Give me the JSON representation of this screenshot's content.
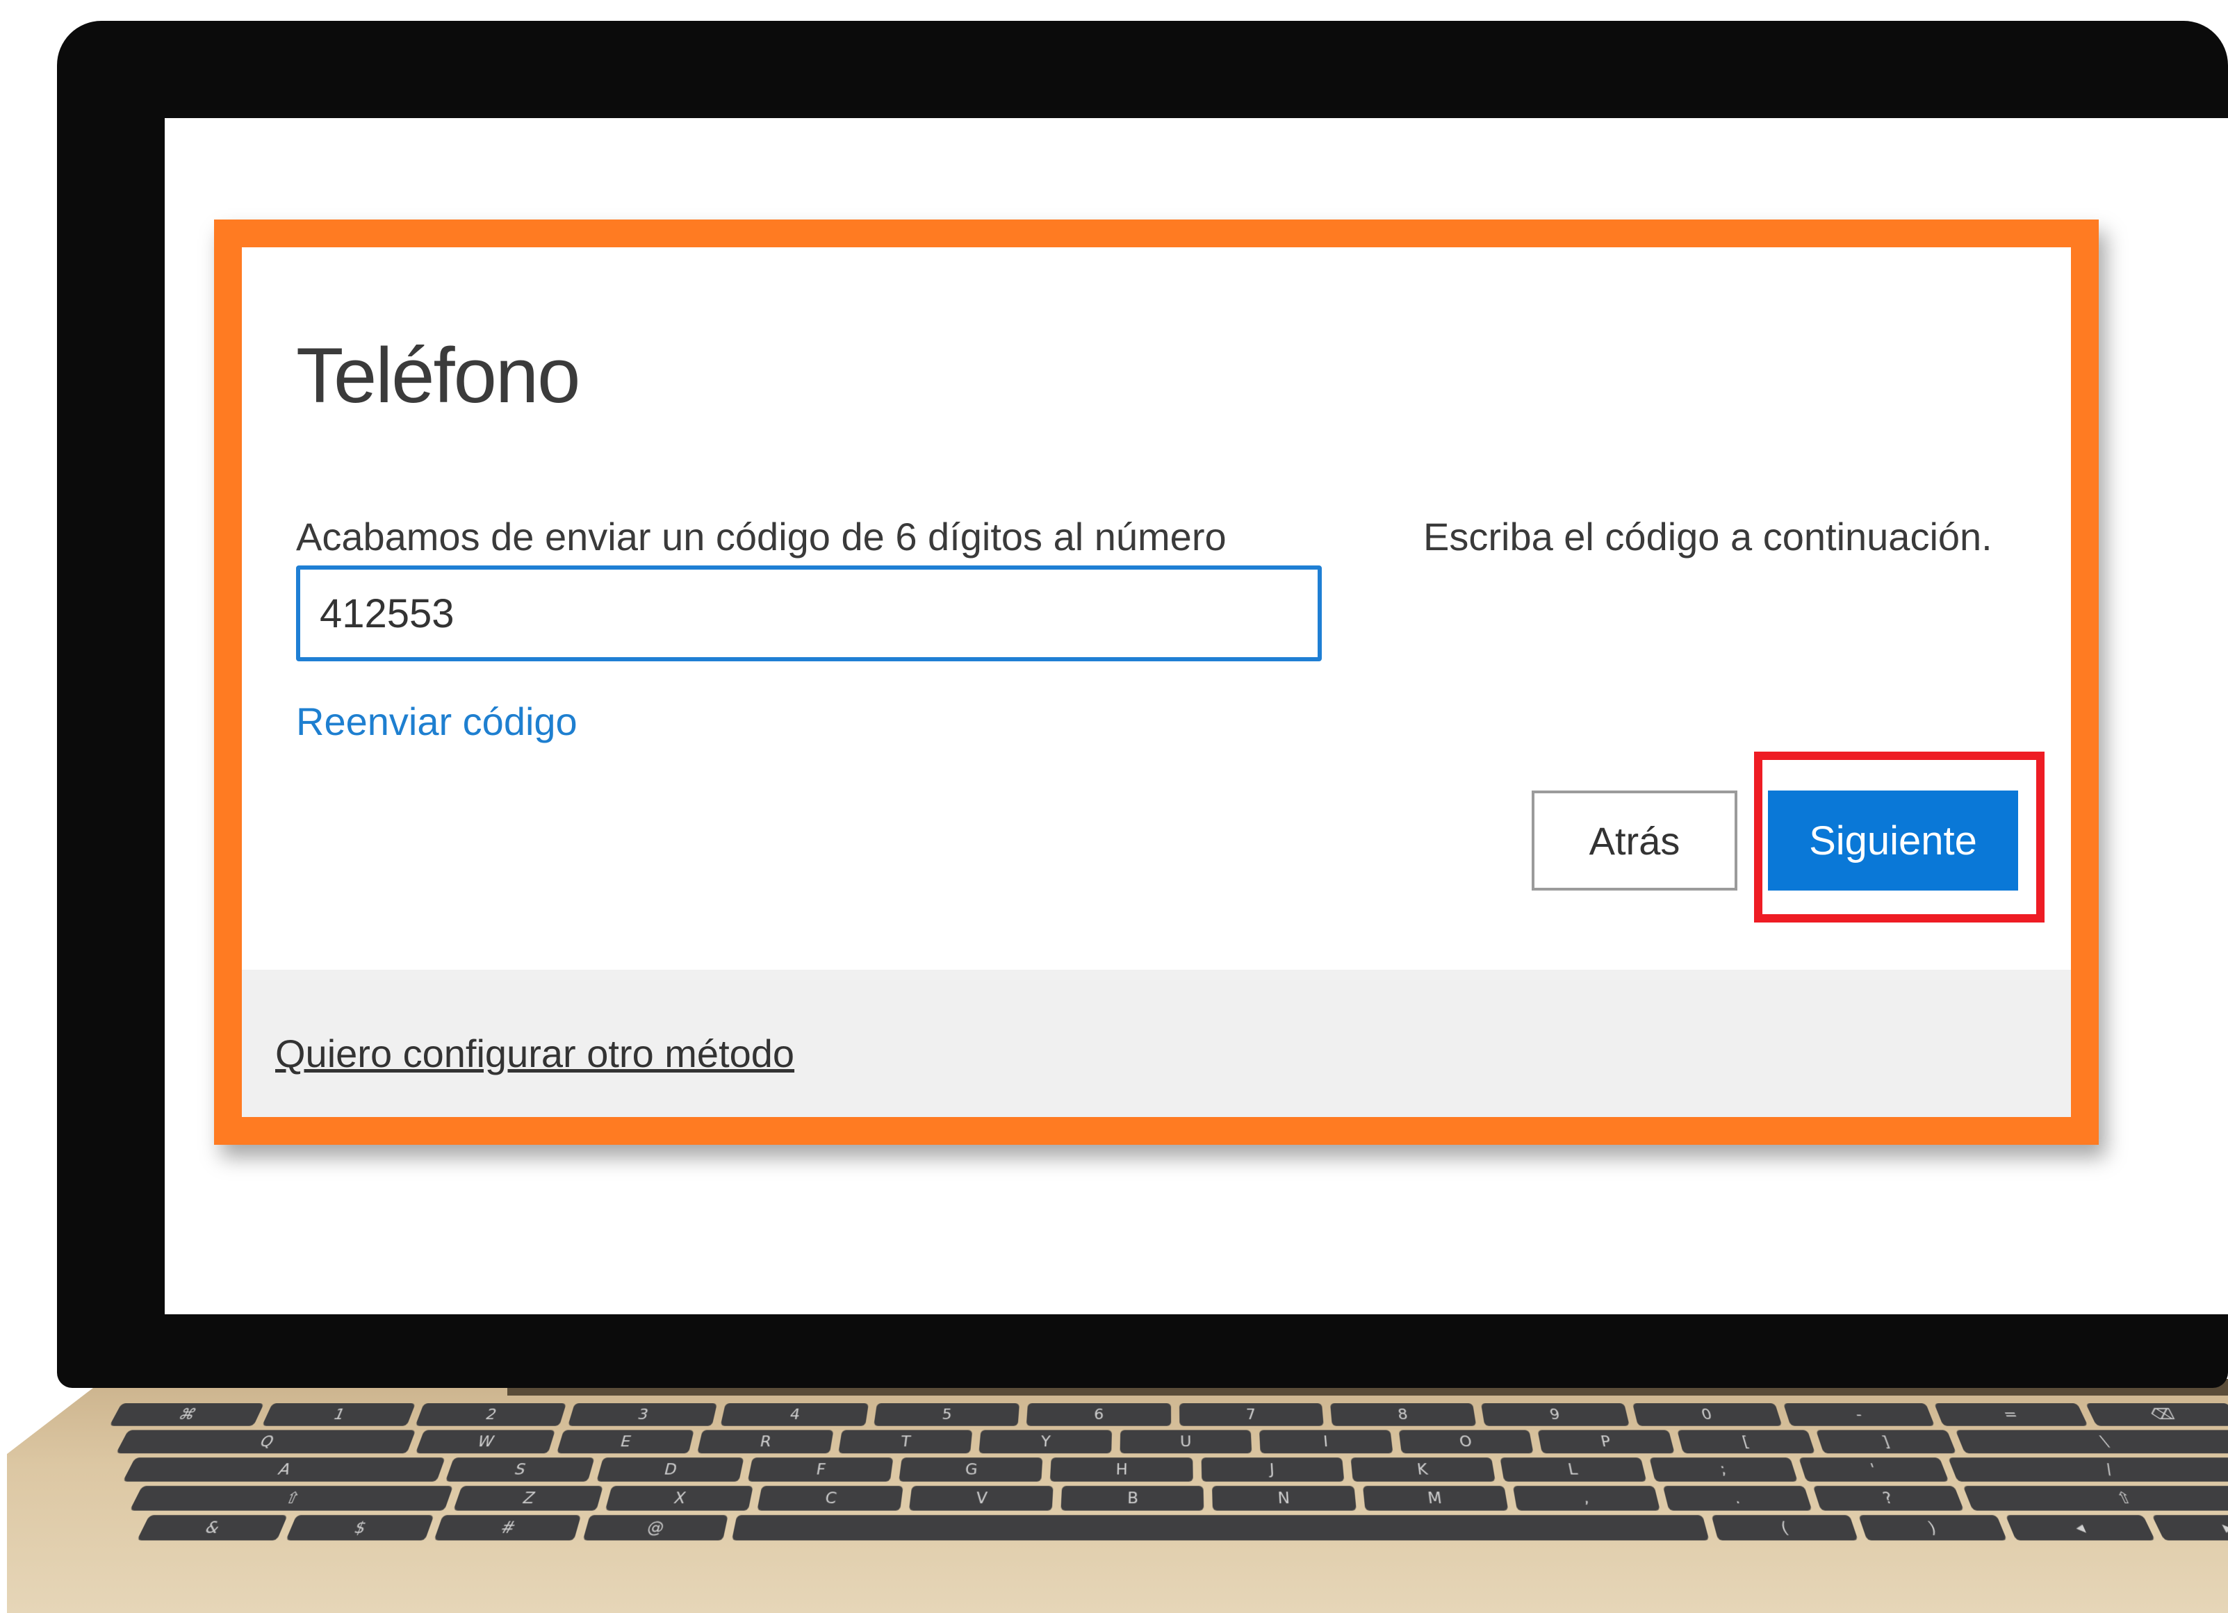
{
  "dialog": {
    "title": "Teléfono",
    "instruction": "Acabamos de enviar un código de 6 dígitos al número",
    "instruction_right": "Escriba el código a continuación.",
    "code_value": "412553",
    "resend_link": "Reenviar código",
    "back_button": "Atrás",
    "next_button": "Siguiente",
    "other_method_link": "Quiero configurar otro método"
  },
  "keyboard": {
    "rows": [
      [
        "⌘",
        "1",
        "2",
        "3",
        "4",
        "5",
        "6",
        "7",
        "8",
        "9",
        "0",
        "-",
        "=",
        "⌫"
      ],
      [
        "Q",
        "W",
        "E",
        "R",
        "T",
        "Y",
        "U",
        "I",
        "O",
        "P",
        "[",
        "]",
        "\\"
      ],
      [
        "A",
        "S",
        "D",
        "F",
        "G",
        "H",
        "J",
        "K",
        "L",
        ";",
        "'",
        "/"
      ],
      [
        "⇧",
        "Z",
        "X",
        "C",
        "V",
        "B",
        "N",
        "M",
        ",",
        ".",
        "?",
        "⇧"
      ],
      [
        "&",
        "$",
        "#",
        "@",
        " ",
        "(",
        ")",
        "◂",
        "▸"
      ]
    ]
  },
  "colors": {
    "frame_orange": "#ff7b22",
    "highlight_red": "#ee1c24",
    "primary_blue": "#0a78d7",
    "link_blue": "#1e7fd0"
  }
}
